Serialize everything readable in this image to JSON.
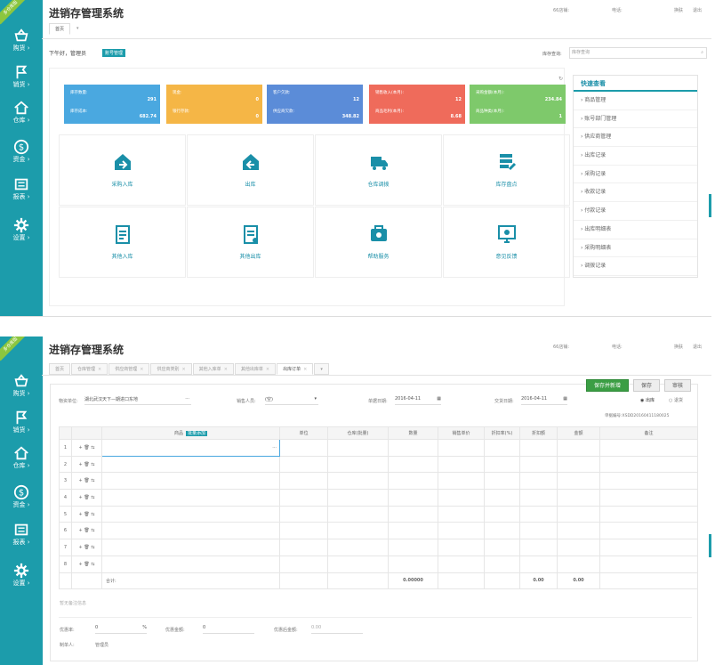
{
  "app": {
    "title": "进销存管理系统",
    "badge": "多仓库版"
  },
  "sidebar": [
    {
      "label": "购货",
      "icon": "basket-icon"
    },
    {
      "label": "销货",
      "icon": "flag-icon"
    },
    {
      "label": "仓库",
      "icon": "house-icon"
    },
    {
      "label": "资金",
      "icon": "dollar-icon"
    },
    {
      "label": "报表",
      "icon": "report-icon"
    },
    {
      "label": "设置",
      "icon": "gear-icon"
    }
  ],
  "header": {
    "items": [
      "66店铺:",
      "电话:",
      "换肤",
      "退出"
    ]
  },
  "screen1": {
    "tabs": [
      "首页"
    ],
    "greeting": "下午好，管理员",
    "greeting_badge": "账号管理",
    "stock_query_label": "库存查询:",
    "stock_query_placeholder": "库存查询",
    "cards": [
      {
        "l1": "库存数量:",
        "v1": "291",
        "l2": "库存成本:",
        "v2": "682.74",
        "color": "#4aa8e0"
      },
      {
        "l1": "现金:",
        "v1": "0",
        "l2": "银行存款:",
        "v2": "0",
        "color": "#f5b646"
      },
      {
        "l1": "客户欠款:",
        "v1": "12",
        "l2": "供应商欠款:",
        "v2": "348.82",
        "color": "#5b8cd8"
      },
      {
        "l1": "销售收入(本月):",
        "v1": "12",
        "l2": "商品毛利(本月):",
        "v2": "8.68",
        "color": "#ef6b5b"
      },
      {
        "l1": "采购金额(本月):",
        "v1": "234.84",
        "l2": "商品种类(本月):",
        "v2": "1",
        "color": "#7ec96b"
      }
    ],
    "tiles": [
      {
        "label": "采购入库",
        "icon": "purchase-in-icon"
      },
      {
        "label": "出库",
        "icon": "stock-out-icon"
      },
      {
        "label": "仓库调拨",
        "icon": "transfer-truck-icon"
      },
      {
        "label": "库存盘点",
        "icon": "inventory-check-icon"
      },
      {
        "label": "其他入库",
        "icon": "other-in-icon"
      },
      {
        "label": "其他出库",
        "icon": "other-out-icon"
      },
      {
        "label": "帮助服务",
        "icon": "help-service-icon"
      },
      {
        "label": "意见反馈",
        "icon": "feedback-icon"
      }
    ],
    "quick_access": {
      "title": "快速查看",
      "items": [
        "商品管理",
        "账号部门管理",
        "供应商管理",
        "出库记录",
        "采购记录",
        "收款记录",
        "付款记录",
        "出库明细表",
        "采购明细表",
        "调拨记录"
      ]
    }
  },
  "screen2": {
    "tabs": [
      "首页",
      "仓库管理",
      "供应商管理",
      "供应商类别",
      "其他入库单",
      "其他出库单",
      "出库订单"
    ],
    "buttons": {
      "save_new": "保存并新增",
      "save": "保存",
      "audit": "审核"
    },
    "form": {
      "warehouse_label": "物资单位:",
      "warehouse_value": "湖北武汉天下—期进口东地",
      "sales_label": "销售人员:",
      "sales_value": "(空)",
      "date_label": "单据日期:",
      "date_value": "2016-04-11",
      "deliver_label": "交货日期:",
      "deliver_value": "2016-04-11",
      "radio_out": "出库",
      "radio_return": "退货",
      "doc_no": "单据编号:XSDD20160411180025"
    },
    "table": {
      "headers": [
        "",
        "",
        "商品",
        "单位",
        "仓库(批量)",
        "数量",
        "销售单价",
        "折扣率(%)",
        "折扣额",
        "金额",
        "备注"
      ],
      "product_search_badge": "批量添加",
      "rows": [
        "1",
        "2",
        "3",
        "4",
        "5",
        "6",
        "7",
        "8"
      ],
      "total_label": "合计:",
      "total_qty": "0.00000",
      "total_discount": "0.00",
      "total_amount": "0.00"
    },
    "remark_placeholder": "暂无备注信息",
    "footer": {
      "discount_rate_label": "优惠率:",
      "discount_rate_value": "0",
      "percent": "%",
      "discount_amt_label": "优惠金额:",
      "discount_amt_value": "0",
      "after_label": "优惠后金额:",
      "after_value": "0.00",
      "maker_label": "制单人:",
      "maker_value": "管理员"
    }
  }
}
